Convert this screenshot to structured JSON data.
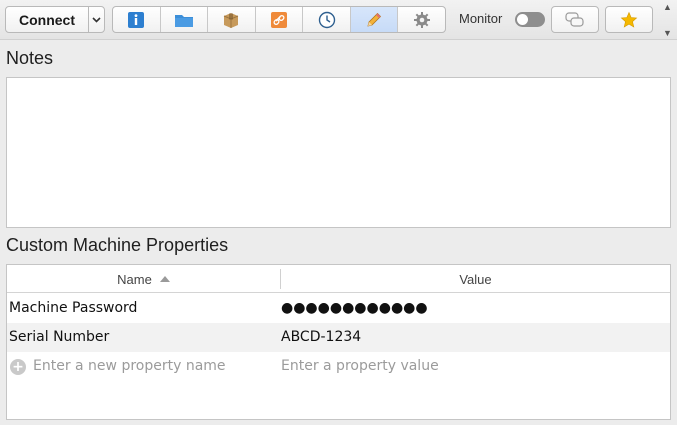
{
  "toolbar": {
    "connect_label": "Connect",
    "monitor_label": "Monitor",
    "monitor_on": false,
    "segments": [
      {
        "icon": "info-icon",
        "active": false
      },
      {
        "icon": "folder-icon",
        "active": false
      },
      {
        "icon": "package-icon",
        "active": false
      },
      {
        "icon": "link-icon",
        "active": false
      },
      {
        "icon": "clock-icon",
        "active": false
      },
      {
        "icon": "pencil-icon",
        "active": true
      },
      {
        "icon": "gear-icon",
        "active": false
      }
    ]
  },
  "notes": {
    "title": "Notes",
    "value": ""
  },
  "properties": {
    "title": "Custom Machine Properties",
    "columns": {
      "name": "Name",
      "value": "Value"
    },
    "rows": [
      {
        "name": "Machine Password",
        "value": "●●●●●●●●●●●●"
      },
      {
        "name": "Serial Number",
        "value": "ABCD-1234"
      }
    ],
    "new_row": {
      "name_placeholder": "Enter a new property name",
      "value_placeholder": "Enter a property value"
    }
  },
  "colors": {
    "accent": "#3b8fd6",
    "toggle_off": "#8e8e8e",
    "star": "#f5b800"
  }
}
